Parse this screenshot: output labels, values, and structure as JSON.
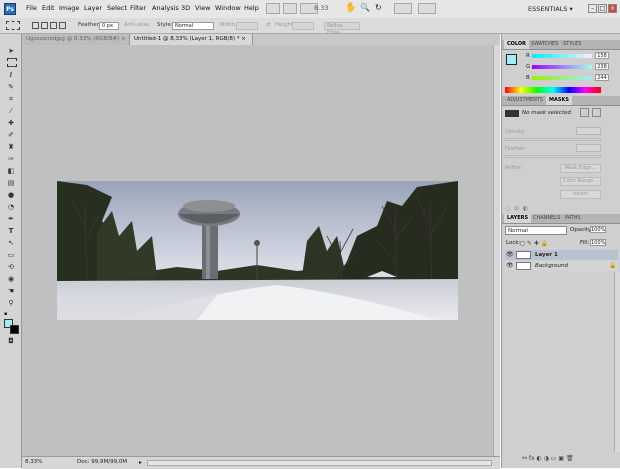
{
  "app": {
    "logo": "Ps"
  },
  "menu": [
    "File",
    "Edit",
    "Image",
    "Layer",
    "Select",
    "Filter",
    "Analysis",
    "3D",
    "View",
    "Window",
    "Help"
  ],
  "toolbar": {
    "zoom_value": "8.33",
    "workspace": "ESSENTIALS ▾",
    "win_min": "–",
    "win_max": "□",
    "win_close": "×"
  },
  "options": {
    "feather_label": "Feather:",
    "feather_value": "0 px",
    "antialias": "Anti-alias",
    "style_label": "Style:",
    "style_value": "Normal",
    "width_label": "Width:",
    "height_label": "Height:",
    "refine_edge": "Refine Edge..."
  },
  "tabs": [
    {
      "label": "Ugoszanedjpg @ 8,33% (RGB/8#) ×"
    },
    {
      "label": "Untitled-1 @ 8,33% (Layer 1, RGB/8) * ×"
    }
  ],
  "status": {
    "zoom": "8,33%",
    "doc": "Doc: 99,9M/99,0M"
  },
  "color_panel": {
    "tabs": [
      "COLOR",
      "SWATCHES",
      "STYLES"
    ],
    "channels": [
      {
        "label": "R",
        "value": "158"
      },
      {
        "label": "G",
        "value": "238"
      },
      {
        "label": "B",
        "value": "244"
      }
    ],
    "fg_color": "#9eeef4"
  },
  "adjust_panel": {
    "tabs": [
      "ADJUSTMENTS",
      "MASKS"
    ],
    "no_mask": "No mask selected",
    "density": "Density:",
    "feather": "Feather:",
    "refine": "Refine:",
    "mask_edge": "Mask Edge...",
    "color_range": "Color Range...",
    "invert": "Invert"
  },
  "layers_panel": {
    "tabs": [
      "LAYERS",
      "CHANNELS",
      "PATHS"
    ],
    "blend_mode": "Normal",
    "opacity_label": "Opacity:",
    "opacity_value": "100%",
    "lock_label": "Lock:",
    "fill_label": "Fill:",
    "fill_value": "100%",
    "layers": [
      {
        "name": "Layer 1",
        "selected": true
      },
      {
        "name": "Background",
        "selected": false
      }
    ]
  }
}
